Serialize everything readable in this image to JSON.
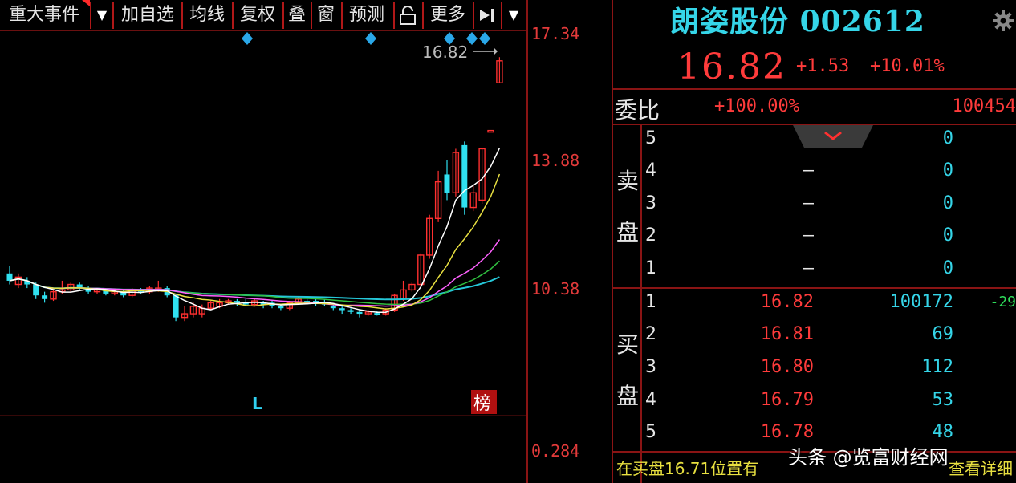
{
  "toolbar": {
    "items": [
      {
        "label": "重大事件"
      },
      {
        "label": "加自选"
      },
      {
        "label": "均线"
      },
      {
        "label": "复权"
      },
      {
        "label": "叠"
      },
      {
        "label": "窗"
      },
      {
        "label": "预测"
      },
      {
        "label": "更多"
      }
    ],
    "dropdown_glyph": "▼",
    "lock_icon": "lock-icon",
    "step_icon": "step-forward-icon"
  },
  "chart": {
    "price_axis_labels": [
      "17.34",
      "13.88",
      "10.38",
      "0.284"
    ],
    "last_price_marker": "16.82",
    "marker_L": "L",
    "rank_badge": "榜",
    "colors": {
      "up": "#ff3030",
      "down": "#30e0f0",
      "ma5": "#ffffff",
      "ma10": "#e8e040",
      "ma20": "#ff60ff",
      "ma60": "#30c040",
      "marker": "#2aa7e8"
    }
  },
  "quote": {
    "name_code": "朗姿股份 002612",
    "price": "16.82",
    "change": "+1.53",
    "change_pct": "+10.01%",
    "weibi_label": "委比",
    "weibi_pct": "+100.00%",
    "weibi_diff": "100454"
  },
  "orderbook": {
    "sell_label": "卖盘",
    "buy_label": "买盘",
    "sell": [
      {
        "level": "5",
        "price": "",
        "vol": "0"
      },
      {
        "level": "4",
        "price": "—",
        "vol": "0"
      },
      {
        "level": "3",
        "price": "—",
        "vol": "0"
      },
      {
        "level": "2",
        "price": "—",
        "vol": "0"
      },
      {
        "level": "1",
        "price": "—",
        "vol": "0"
      }
    ],
    "buy": [
      {
        "level": "1",
        "price": "16.82",
        "vol": "100172",
        "chg": "-29"
      },
      {
        "level": "2",
        "price": "16.81",
        "vol": "69",
        "chg": ""
      },
      {
        "level": "3",
        "price": "16.80",
        "vol": "112",
        "chg": ""
      },
      {
        "level": "4",
        "price": "16.79",
        "vol": "53",
        "chg": ""
      },
      {
        "level": "5",
        "price": "16.78",
        "vol": "48",
        "chg": ""
      }
    ]
  },
  "status": {
    "text": "在买盘16.71位置有",
    "link": "查看详细"
  },
  "watermark": "头条 @览富财经网"
}
